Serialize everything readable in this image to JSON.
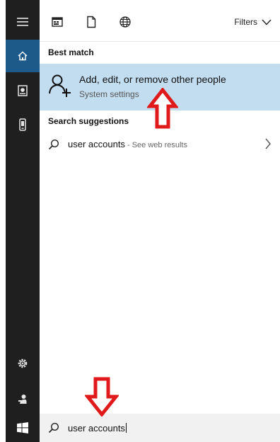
{
  "rail": {
    "items": [
      {
        "name": "menu",
        "icon": "hamburger-icon"
      },
      {
        "name": "home",
        "icon": "home-icon"
      },
      {
        "name": "documents",
        "icon": "documents-icon"
      },
      {
        "name": "phone",
        "icon": "phone-icon"
      },
      {
        "name": "settings",
        "icon": "gear-icon"
      },
      {
        "name": "user",
        "icon": "user-icon"
      },
      {
        "name": "start",
        "icon": "windows-icon"
      }
    ]
  },
  "topbar": {
    "filters_label": "Filters",
    "filter_icons": [
      "apps-icon",
      "document-icon",
      "web-icon"
    ]
  },
  "best_match": {
    "heading": "Best match",
    "title": "Add, edit, or remove other people",
    "subtitle": "System settings",
    "icon": "person-add-icon"
  },
  "suggestions": {
    "heading": "Search suggestions",
    "items": [
      {
        "query": "user accounts",
        "hint": " - See web results"
      }
    ]
  },
  "search": {
    "value": "user accounts"
  },
  "colors": {
    "rail": "#1f1f1f",
    "rail_active": "#1d5a8a",
    "highlight": "#c2dcf0",
    "annotation": "#e01a1a"
  }
}
